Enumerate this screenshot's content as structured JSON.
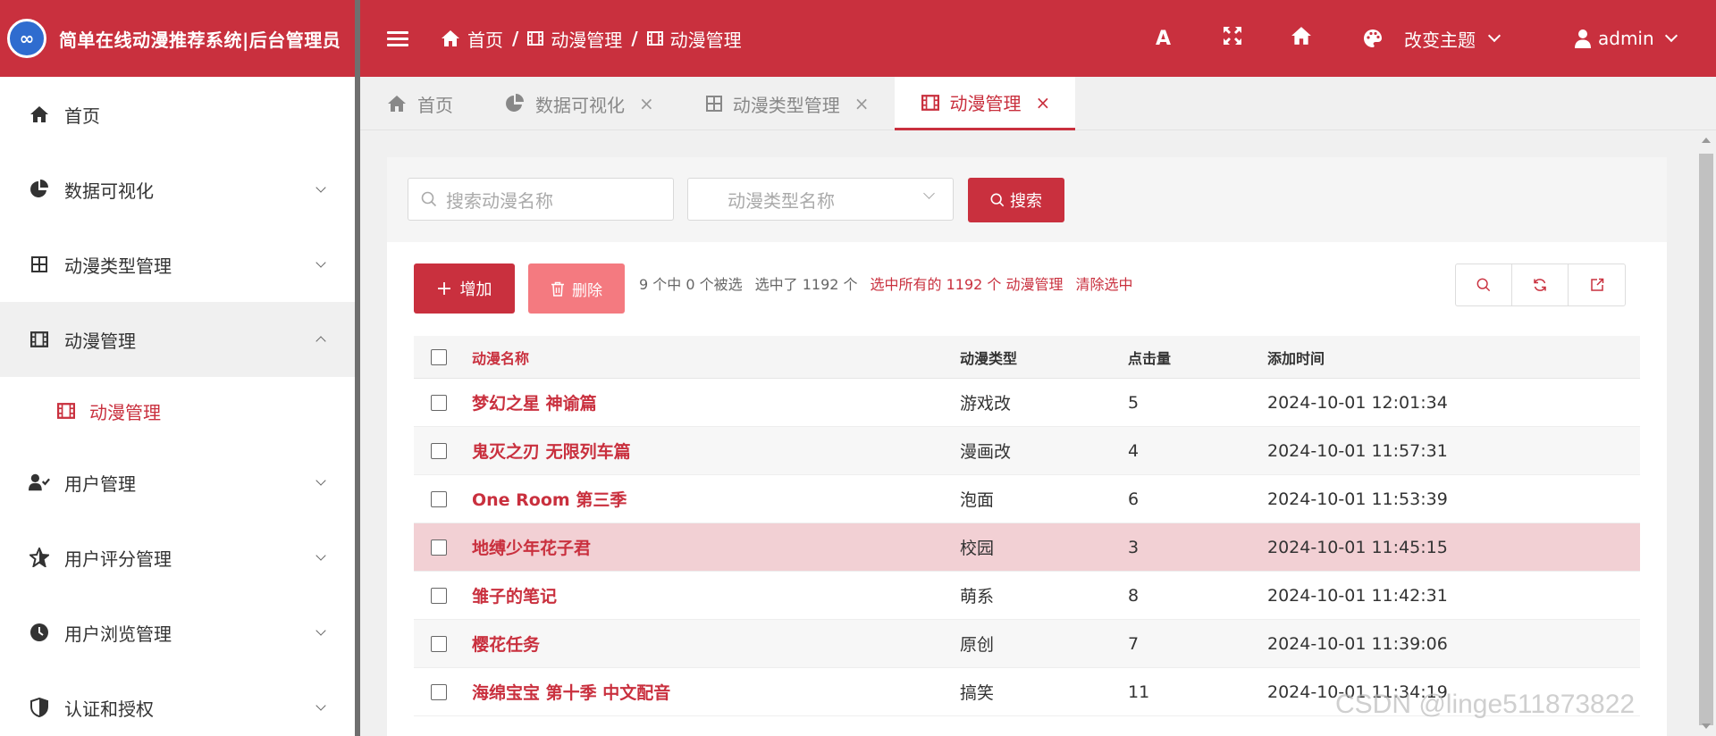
{
  "brand": {
    "title": "简单在线动漫推荐系统|后台管理员",
    "logo_text": "∞"
  },
  "breadcrumb": [
    {
      "label": "首页",
      "icon": "home-icon"
    },
    {
      "label": "动漫管理",
      "icon": "film-icon"
    },
    {
      "label": "动漫管理",
      "icon": "film-icon"
    }
  ],
  "header": {
    "font_icon_label": "A",
    "theme_label": "改变主题",
    "user_label": "admin"
  },
  "sidebar": {
    "items": [
      {
        "label": "首页",
        "icon": "home-icon"
      },
      {
        "label": "数据可视化",
        "icon": "pie-chart-icon"
      },
      {
        "label": "动漫类型管理",
        "icon": "grid-icon"
      },
      {
        "label": "动漫管理",
        "icon": "film-icon"
      },
      {
        "label": "用户管理",
        "icon": "user-check-icon"
      },
      {
        "label": "用户评分管理",
        "icon": "star-icon"
      },
      {
        "label": "用户浏览管理",
        "icon": "clock-icon"
      },
      {
        "label": "认证和授权",
        "icon": "shield-icon"
      }
    ],
    "submenu_label": "动漫管理"
  },
  "tabs": [
    {
      "label": "首页",
      "closable": false
    },
    {
      "label": "数据可视化",
      "closable": true
    },
    {
      "label": "动漫类型管理",
      "closable": true
    },
    {
      "label": "动漫管理",
      "closable": true
    }
  ],
  "tab_close": "×",
  "search": {
    "name_placeholder": "搜索动漫名称",
    "type_placeholder": "动漫类型名称",
    "button_label": "搜索"
  },
  "actions": {
    "add_label": "增加",
    "delete_label": "删除",
    "selected_count": "9 个中 0 个被选",
    "selected_total": "选中了 1192 个",
    "select_all": "选中所有的 1192 个 动漫管理",
    "clear_selection": "清除选中"
  },
  "table": {
    "columns": [
      "动漫名称",
      "动漫类型",
      "点击量",
      "添加时间"
    ],
    "rows": [
      {
        "name": "梦幻之星 神谕篇",
        "type": "游戏改",
        "clicks": "5",
        "time": "2024-10-01 12:01:34"
      },
      {
        "name": "鬼灭之刃 无限列车篇",
        "type": "漫画改",
        "clicks": "4",
        "time": "2024-10-01 11:57:31"
      },
      {
        "name": "One Room 第三季",
        "type": "泡面",
        "clicks": "6",
        "time": "2024-10-01 11:53:39"
      },
      {
        "name": "地缚少年花子君",
        "type": "校园",
        "clicks": "3",
        "time": "2024-10-01 11:45:15"
      },
      {
        "name": "雏子的笔记",
        "type": "萌系",
        "clicks": "8",
        "time": "2024-10-01 11:42:31"
      },
      {
        "name": "樱花任务",
        "type": "原创",
        "clicks": "7",
        "time": "2024-10-01 11:39:06"
      },
      {
        "name": "海绵宝宝 第十季 中文配音",
        "type": "搞笑",
        "clicks": "11",
        "time": "2024-10-01 11:34:19"
      }
    ]
  },
  "watermark": "CSDN @linge511873822",
  "colors": {
    "primary": "#c9303e",
    "highlight_row": "#f2d0d4",
    "delete_button": "#f47a80"
  }
}
